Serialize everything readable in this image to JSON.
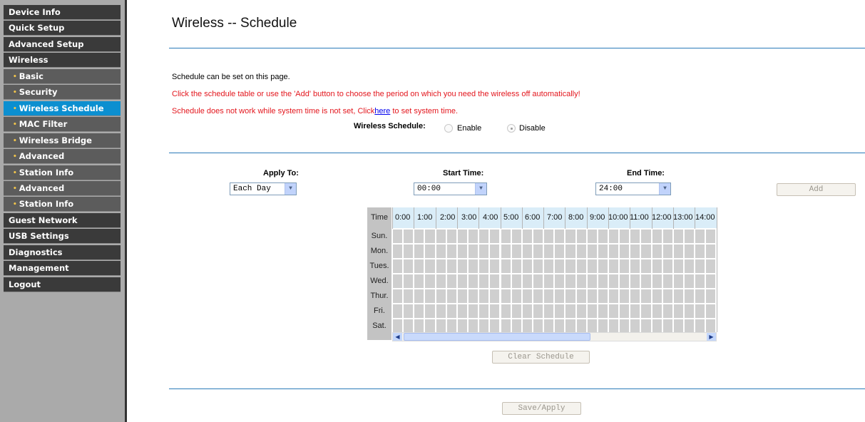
{
  "sidebar": {
    "items": [
      {
        "label": "Device Info",
        "kind": "main"
      },
      {
        "label": "Quick Setup",
        "kind": "main"
      },
      {
        "label": "Advanced Setup",
        "kind": "main"
      },
      {
        "label": "Wireless",
        "kind": "main"
      },
      {
        "label": "Basic",
        "kind": "sub"
      },
      {
        "label": "Security",
        "kind": "sub"
      },
      {
        "label": "Wireless Schedule",
        "kind": "sub",
        "active": true
      },
      {
        "label": "MAC Filter",
        "kind": "sub"
      },
      {
        "label": "Wireless Bridge",
        "kind": "sub"
      },
      {
        "label": "Advanced",
        "kind": "sub"
      },
      {
        "label": "Station Info",
        "kind": "sub"
      },
      {
        "label": "Advanced",
        "kind": "sub"
      },
      {
        "label": "Station Info",
        "kind": "sub"
      },
      {
        "label": "Guest Network",
        "kind": "main"
      },
      {
        "label": "USB Settings",
        "kind": "main"
      },
      {
        "label": "Diagnostics",
        "kind": "main"
      },
      {
        "label": "Management",
        "kind": "main"
      },
      {
        "label": "Logout",
        "kind": "main"
      }
    ]
  },
  "page": {
    "title": "Wireless -- Schedule",
    "info": "Schedule can be set on this page.",
    "warning1": "Click the schedule table or use the 'Add' button to choose the period on which you need the wireless off automatically!",
    "warning2_prefix": "Schedule does not work while system time is not set, Click",
    "warning2_link": "here",
    "warning2_suffix": "to set system time."
  },
  "schedule": {
    "label": "Wireless Schedule:",
    "enable_label": "Enable",
    "disable_label": "Disable",
    "selected": "Disable"
  },
  "controls": {
    "apply_to_label": "Apply To:",
    "apply_to_value": "Each Day",
    "start_time_label": "Start Time:",
    "start_time_value": "00:00",
    "end_time_label": "End Time:",
    "end_time_value": "24:00",
    "add_button": "Add",
    "clear_button": "Clear Schedule",
    "save_button": "Save/Apply"
  },
  "grid": {
    "time_header": "Time",
    "days": [
      "Sun.",
      "Mon.",
      "Tues.",
      "Wed.",
      "Thur.",
      "Fri.",
      "Sat."
    ],
    "hours": [
      "0:00",
      "1:00",
      "2:00",
      "3:00",
      "4:00",
      "5:00",
      "6:00",
      "7:00",
      "8:00",
      "9:00",
      "10:00",
      "11:00",
      "12:00",
      "13:00",
      "14:00"
    ]
  },
  "colors": {
    "active_nav": "#0c8fd0",
    "warning_text": "#e3161d",
    "rule_line": "#2a7ab8"
  }
}
